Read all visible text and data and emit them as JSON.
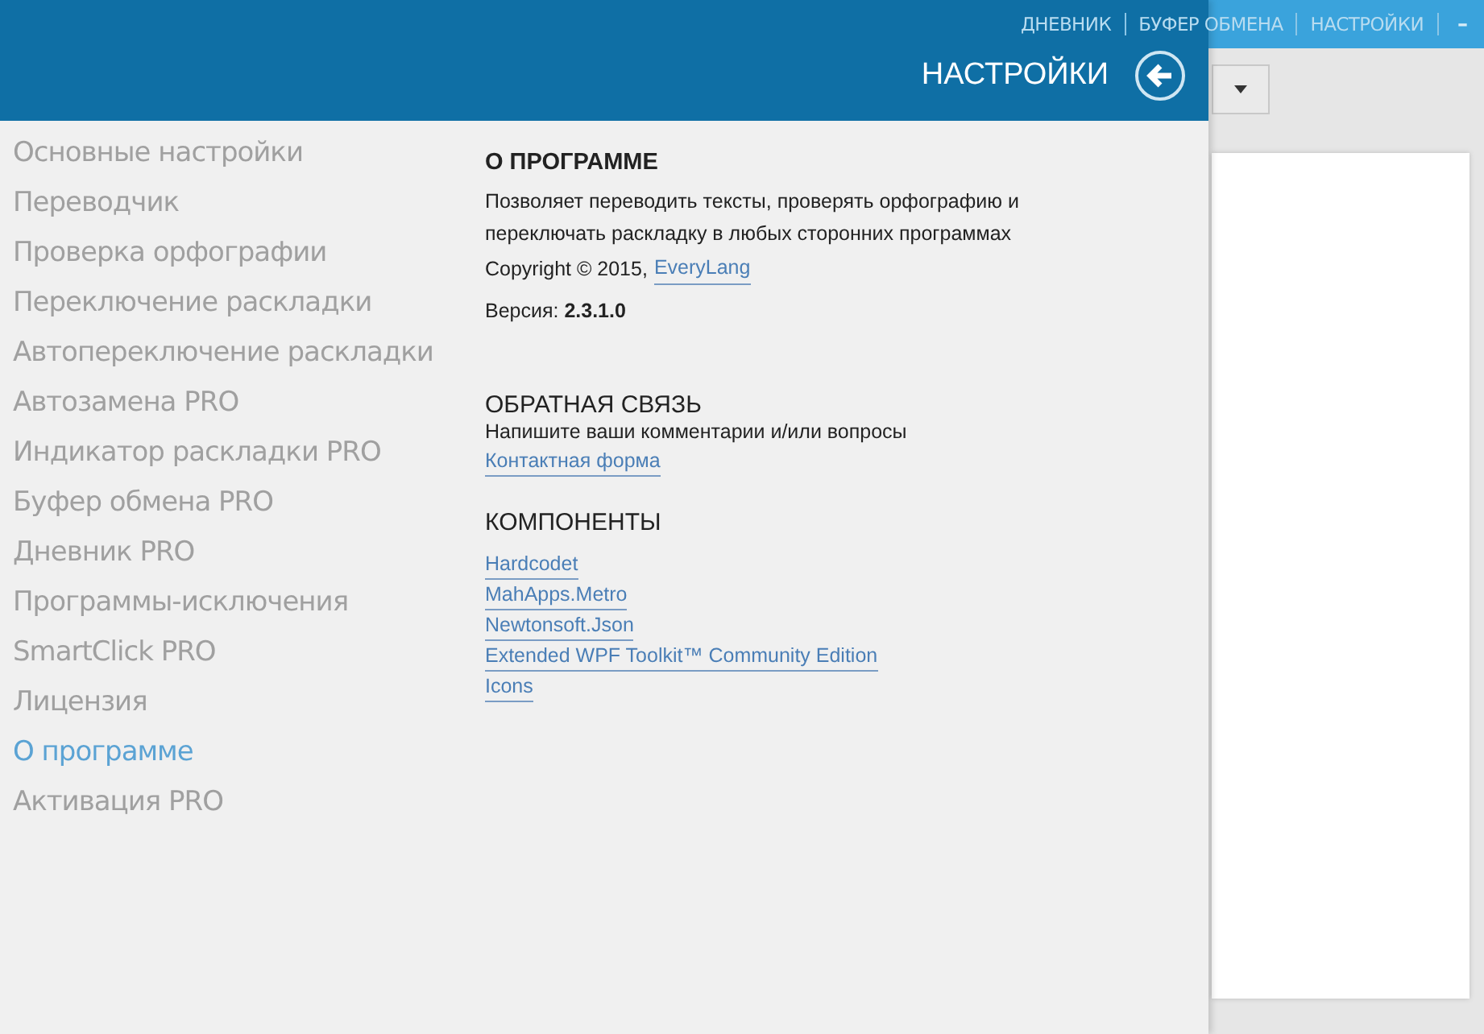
{
  "top_links": [
    "ДНЕВНИК",
    "БУФЕР ОБМЕНА",
    "НАСТРОЙКИ"
  ],
  "window_controls": [
    "–"
  ],
  "flyout": {
    "title": "НАСТРОЙКИ"
  },
  "sidebar": {
    "items": [
      {
        "label": "Основные настройки",
        "selected": false
      },
      {
        "label": "Переводчик",
        "selected": false
      },
      {
        "label": "Проверка орфографии",
        "selected": false
      },
      {
        "label": "Переключение раскладки",
        "selected": false
      },
      {
        "label": "Автопереключение раскладки",
        "selected": false
      },
      {
        "label": "Автозамена PRO",
        "selected": false
      },
      {
        "label": "Индикатор раскладки PRO",
        "selected": false
      },
      {
        "label": "Буфер обмена PRO",
        "selected": false
      },
      {
        "label": "Дневник PRO",
        "selected": false
      },
      {
        "label": "Программы-исключения",
        "selected": false
      },
      {
        "label": "SmartClick PRO",
        "selected": false
      },
      {
        "label": "Лицензия",
        "selected": false
      },
      {
        "label": "О программе",
        "selected": true
      },
      {
        "label": "Активация PRO",
        "selected": false
      }
    ]
  },
  "about": {
    "heading": "О ПРОГРАММЕ",
    "description": "Позволяет переводить тексты, проверять орфографию и переключать раскладку в любых сторонних программах",
    "copyright": "Copyright © 2015,",
    "copyright_link": "EveryLang",
    "version": "Версия: **2.3.1.0**"
  },
  "feedback": {
    "heading": "ОБРАТНАЯ СВЯЗЬ",
    "text": "Напишите ваши комментарии и/или вопросы",
    "link": "Контактная форма"
  },
  "components": {
    "heading": "КОМПОНЕНТЫ",
    "links": [
      "Hardcodet",
      "MahApps.Metro",
      "Newtonsoft.Json",
      "Extended WPF Toolkit™ Community Edition",
      "Icons"
    ]
  }
}
